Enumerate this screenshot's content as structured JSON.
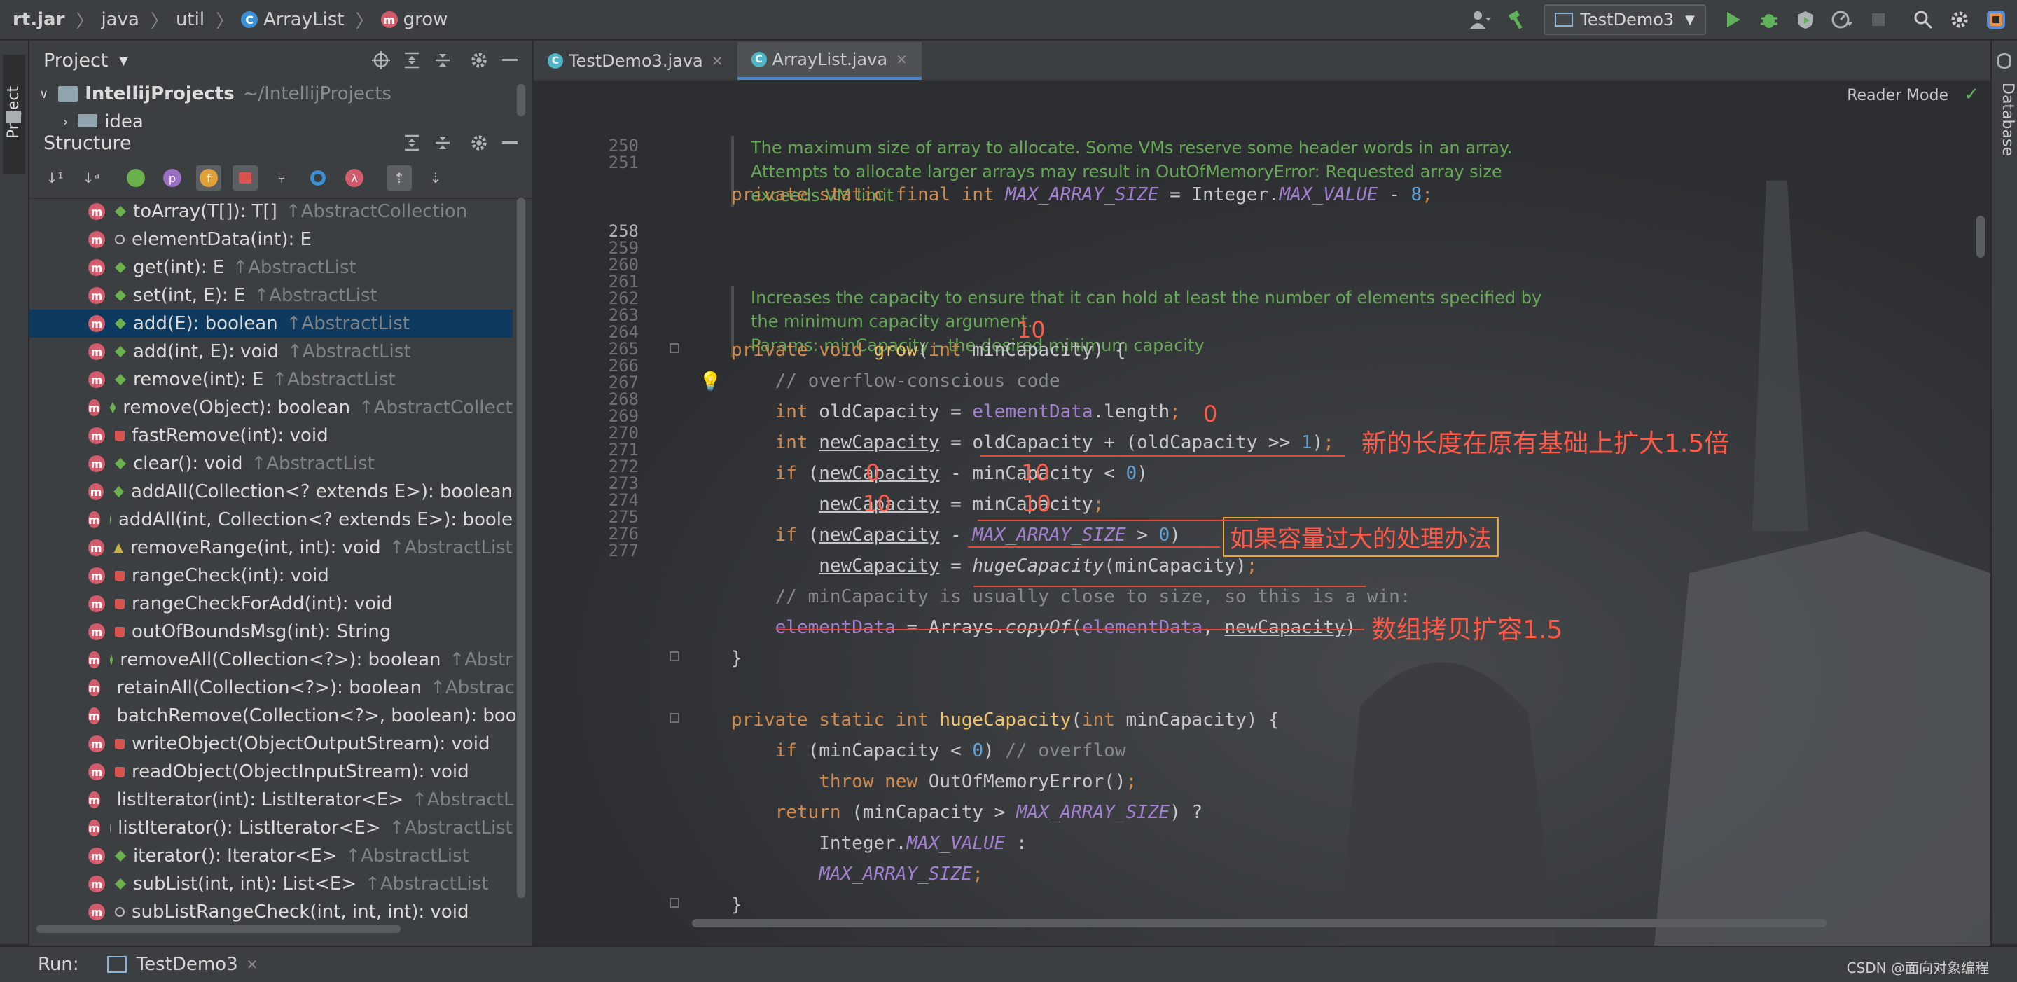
{
  "breadcrumb": {
    "items": [
      "rt.jar",
      "java",
      "util",
      "ArrayList",
      "grow"
    ]
  },
  "toolbar": {
    "run_config": "TestDemo3"
  },
  "stripes": {
    "left_tab": "Project",
    "right_tab": "Database"
  },
  "project": {
    "header": "Project",
    "root_name": "IntellijProjects",
    "root_path": "~/IntellijProjects",
    "child": "idea"
  },
  "structure": {
    "header": "Structure",
    "members": [
      {
        "sig": "toArray(T[]): T[]",
        "inh": "↑AbstractCollection",
        "vis": "pub"
      },
      {
        "sig": "elementData(int): E",
        "inh": "",
        "vis": "pkg"
      },
      {
        "sig": "get(int): E",
        "inh": "↑AbstractList",
        "vis": "pub"
      },
      {
        "sig": "set(int, E): E",
        "inh": "↑AbstractList",
        "vis": "pub"
      },
      {
        "sig": "add(E): boolean",
        "inh": "↑AbstractList",
        "vis": "pub"
      },
      {
        "sig": "add(int, E): void",
        "inh": "↑AbstractList",
        "vis": "pub"
      },
      {
        "sig": "remove(int): E",
        "inh": "↑AbstractList",
        "vis": "pub"
      },
      {
        "sig": "remove(Object): boolean",
        "inh": "↑AbstractCollect",
        "vis": "pub"
      },
      {
        "sig": "fastRemove(int): void",
        "inh": "",
        "vis": "priv"
      },
      {
        "sig": "clear(): void",
        "inh": "↑AbstractList",
        "vis": "pub"
      },
      {
        "sig": "addAll(Collection<? extends E>): boolean",
        "inh": "",
        "vis": "pub"
      },
      {
        "sig": "addAll(int, Collection<? extends E>): boole",
        "inh": "",
        "vis": "pub"
      },
      {
        "sig": "removeRange(int, int): void",
        "inh": "↑AbstractList",
        "vis": "prot"
      },
      {
        "sig": "rangeCheck(int): void",
        "inh": "",
        "vis": "priv"
      },
      {
        "sig": "rangeCheckForAdd(int): void",
        "inh": "",
        "vis": "priv"
      },
      {
        "sig": "outOfBoundsMsg(int): String",
        "inh": "",
        "vis": "priv"
      },
      {
        "sig": "removeAll(Collection<?>): boolean",
        "inh": "↑Abstr",
        "vis": "pub"
      },
      {
        "sig": "retainAll(Collection<?>): boolean",
        "inh": "↑Abstrac",
        "vis": "pub"
      },
      {
        "sig": "batchRemove(Collection<?>, boolean): boo",
        "inh": "",
        "vis": "priv"
      },
      {
        "sig": "writeObject(ObjectOutputStream): void",
        "inh": "",
        "vis": "priv"
      },
      {
        "sig": "readObject(ObjectInputStream): void",
        "inh": "",
        "vis": "priv"
      },
      {
        "sig": "listIterator(int): ListIterator<E>",
        "inh": "↑AbstractL",
        "vis": "pub"
      },
      {
        "sig": "listIterator(): ListIterator<E>",
        "inh": "↑AbstractList",
        "vis": "pub"
      },
      {
        "sig": "iterator(): Iterator<E>",
        "inh": "↑AbstractList",
        "vis": "pub"
      },
      {
        "sig": "subList(int, int): List<E>",
        "inh": "↑AbstractList",
        "vis": "pub"
      },
      {
        "sig": "subListRangeCheck(int, int, int): void",
        "inh": "",
        "vis": "pkg"
      }
    ]
  },
  "editor": {
    "tabs": [
      "TestDemo3.java",
      "ArrayList.java"
    ],
    "reader_mode": "Reader Mode",
    "doc1": [
      "The maximum size of array to allocate. Some VMs reserve some header words in an array.",
      "Attempts to allocate larger arrays may result in OutOfMemoryError: Requested array size",
      "exceeds VM limit"
    ],
    "doc2": [
      "Increases the capacity to ensure that it can hold at least the number of elements specified by",
      "the minimum capacity argument.",
      "Params: minCapacity – the desired minimum capacity"
    ],
    "line_numbers": {
      "l250": "250",
      "l251": "251",
      "l258": "258",
      "l259": "259",
      "l260": "260",
      "l261": "261",
      "l262": "262",
      "l263": "263",
      "l264": "264",
      "l265": "265",
      "l266": "266",
      "l267": "267",
      "l268": "268",
      "l269": "269",
      "l270": "270",
      "l271": "271",
      "l272": "272",
      "l273": "273",
      "l274": "274",
      "l275": "275",
      "l276": "276",
      "l277": "277"
    },
    "code": {
      "c250": "private static final int MAX_ARRAY_SIZE = Integer.MAX_VALUE - 8;",
      "c258": "private void grow(int minCapacity) {",
      "c259": "    // overflow-conscious code",
      "c260": "    int oldCapacity = elementData.length;",
      "c261": "    int newCapacity = oldCapacity + (oldCapacity >> 1);",
      "c262": "    if (newCapacity - minCapacity < 0)",
      "c263": "        newCapacity = minCapacity;",
      "c264": "    if (newCapacity - MAX_ARRAY_SIZE > 0)",
      "c265": "        newCapacity = hugeCapacity(minCapacity);",
      "c266": "    // minCapacity is usually close to size, so this is a win:",
      "c267": "    elementData = Arrays.copyOf(elementData, newCapacity);",
      "c268": "}",
      "c270": "private static int hugeCapacity(int minCapacity) {",
      "c271": "    if (minCapacity < 0) // overflow",
      "c272": "        throw new OutOfMemoryError();",
      "c273": "    return (minCapacity > MAX_ARRAY_SIZE) ?",
      "c274": "        Integer.MAX_VALUE :",
      "c275": "        MAX_ARRAY_SIZE;",
      "c276": "}"
    },
    "annotations": {
      "a_10_top": "10",
      "a_0": "0",
      "a_expand": "新的长度在原有基础上扩大1.5倍",
      "a_0b": "0",
      "a_10b": "10",
      "a_10c": "10",
      "a_10d": "10",
      "a_huge": "如果容量过大的处理办法",
      "a_copy": "数组拷贝扩容1.5"
    }
  },
  "bottom": {
    "run_label": "Run:",
    "run_tab": "TestDemo3",
    "watermark": "CSDN @面向对象编程"
  },
  "colors": {
    "accent": "#4a88c7",
    "annotation": "#ff5a48",
    "doc_comment": "#67a857",
    "keyword": "#d08a4e",
    "selection": "#0d3a5e"
  }
}
